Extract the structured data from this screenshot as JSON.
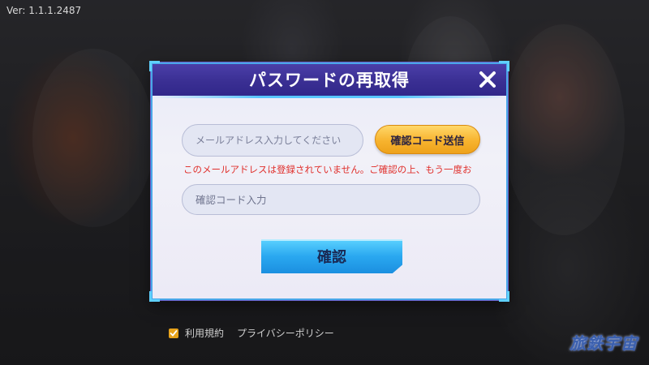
{
  "version": "Ver: 1.1.1.2487",
  "dialog": {
    "title": "パスワードの再取得",
    "email_placeholder": "メールアドレス入力してください",
    "send_code_label": "確認コード送信",
    "error_message": "このメールアドレスは登録されていません。ご確認の上、もう一度お",
    "code_placeholder": "確認コード入力",
    "confirm_label": "確認"
  },
  "footer": {
    "terms_label": "利用規約",
    "privacy_label": "プライバシーポリシー",
    "terms_checked": true
  },
  "logo_text": "旅鉄宇宙",
  "icons": {
    "close": "close-icon",
    "check": "check-icon"
  },
  "colors": {
    "header": "#3a2f93",
    "accent_border": "#49a7e8",
    "send_button": "#f7b32e",
    "confirm_button": "#2aa8f0",
    "error_text": "#e0302c"
  }
}
